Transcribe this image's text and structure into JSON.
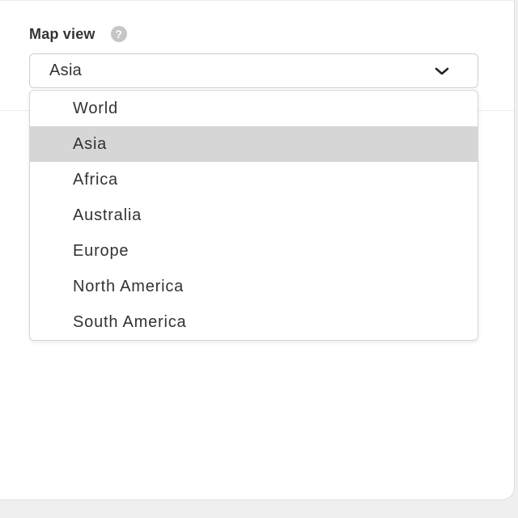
{
  "map_view": {
    "label": "Map view",
    "help_glyph": "?",
    "selected_value": "Asia",
    "options": [
      "World",
      "Asia",
      "Africa",
      "Australia",
      "Europe",
      "North America",
      "South America"
    ],
    "selected_index": 1
  },
  "icons": {
    "help": "help-icon",
    "chevron": "chevron-down-icon"
  },
  "colors": {
    "panel_background": "#ffffff",
    "page_background": "#efefef",
    "selected_option_background": "#d6d6d6",
    "text": "#333333",
    "help_icon": "#c6c6c6"
  }
}
